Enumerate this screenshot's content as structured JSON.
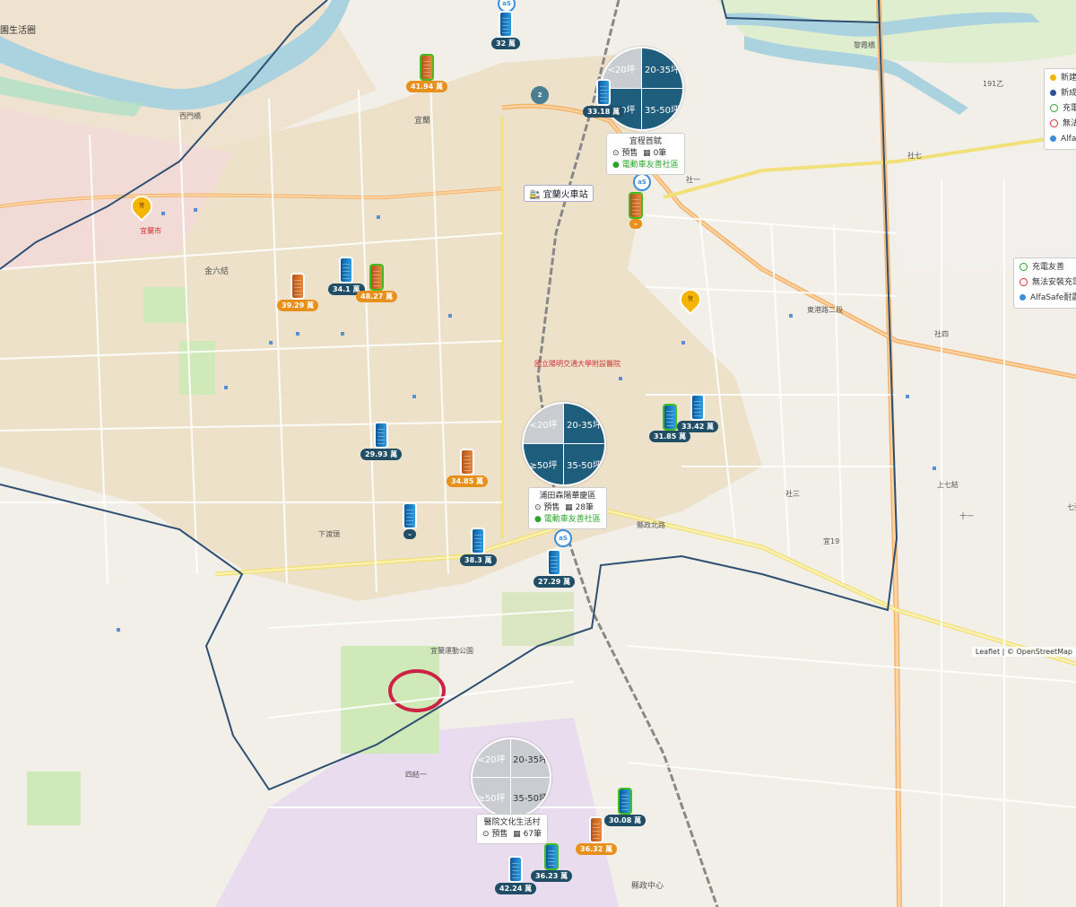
{
  "map": {
    "station_label": "宜蘭火車站",
    "attribution": "Leaflet | © OpenStreetMap",
    "top_left_label": "園生活圈",
    "street_labels": [
      "西門橋",
      "黎霞橋",
      "宜蘭",
      "金六結",
      "社七",
      "社四",
      "社三",
      "社一",
      "上七結",
      "十一",
      "七張",
      "下渡頭",
      "東港路二段",
      "縣政北路",
      "縣政中心",
      "宜蘭運動公園",
      "國立陽明交通大學附設醫院",
      "四結一",
      "191乙",
      "宜蘭市",
      "宜19"
    ]
  },
  "colors": {
    "dark_marker": "#1f4e66",
    "orange_marker": "#e8901c",
    "pie_dark": "#1f5d7c",
    "pie_light": "#c9ccd1",
    "green_text": "#2aa52a"
  },
  "pies": [
    {
      "q1": "<20坪",
      "q2": "20-35坪",
      "q3": "≥50坪",
      "q4": "35-50坪",
      "variant": "dark"
    },
    {
      "q1": "<20坪",
      "q2": "20-35坪",
      "q3": "≥50坪",
      "q4": "35-50坪",
      "variant": "dark"
    },
    {
      "q1": "<20坪",
      "q2": "20-35坪",
      "q3": "≥50坪",
      "q4": "35-50坪",
      "variant": "grey"
    }
  ],
  "infos": [
    {
      "title": "宜程首賦",
      "presale": "預售",
      "count": "0筆",
      "tag": "電動車友善社區"
    },
    {
      "title": "浦田森陽華慶區",
      "presale": "預售",
      "count": "28筆",
      "tag": "電動車友善社區"
    },
    {
      "title": "醫院文化生活村",
      "presale": "預售",
      "count": "67筆",
      "tag": ""
    }
  ],
  "markers": [
    {
      "price": "32 萬",
      "style": "dark",
      "color": "blue",
      "ring": false
    },
    {
      "price": "41.94 萬",
      "style": "orange",
      "color": "orange",
      "ring": true
    },
    {
      "price": "33.18 萬",
      "style": "dark",
      "color": "blue",
      "ring": false
    },
    {
      "price": "–",
      "style": "orange",
      "color": "orange",
      "ring": true
    },
    {
      "price": "34.1 萬",
      "style": "dark",
      "color": "blue",
      "ring": false
    },
    {
      "price": "48.27 萬",
      "style": "orange",
      "color": "orange",
      "ring": true
    },
    {
      "price": "39.29 萬",
      "style": "orange",
      "color": "orange",
      "ring": false
    },
    {
      "price": "31.85 萬",
      "style": "dark",
      "color": "blue",
      "ring": true
    },
    {
      "price": "33.42 萬",
      "style": "dark",
      "color": "blue",
      "ring": false
    },
    {
      "price": "29.93 萬",
      "style": "dark",
      "color": "blue",
      "ring": false
    },
    {
      "price": "34.85 萬",
      "style": "orange",
      "color": "orange",
      "ring": false
    },
    {
      "price": "–",
      "style": "dark",
      "color": "blue",
      "ring": false
    },
    {
      "price": "38.3 萬",
      "style": "dark",
      "color": "blue",
      "ring": false
    },
    {
      "price": "27.29 萬",
      "style": "dark",
      "color": "blue",
      "ring": false
    },
    {
      "price": "30.08 萬",
      "style": "dark",
      "color": "blue",
      "ring": true
    },
    {
      "price": "36.32 萬",
      "style": "orange",
      "color": "orange",
      "ring": false
    },
    {
      "price": "36.23 萬",
      "style": "dark",
      "color": "blue",
      "ring": true
    },
    {
      "price": "42.24 萬",
      "style": "dark",
      "color": "blue",
      "ring": false
    }
  ],
  "legend_top": {
    "items": [
      "新建",
      "新成",
      "充電",
      "無法",
      "Alfa"
    ]
  },
  "legend_mid": {
    "items": [
      "充電友善",
      "無法安裝充電",
      "AlfaSafe耐震"
    ]
  }
}
